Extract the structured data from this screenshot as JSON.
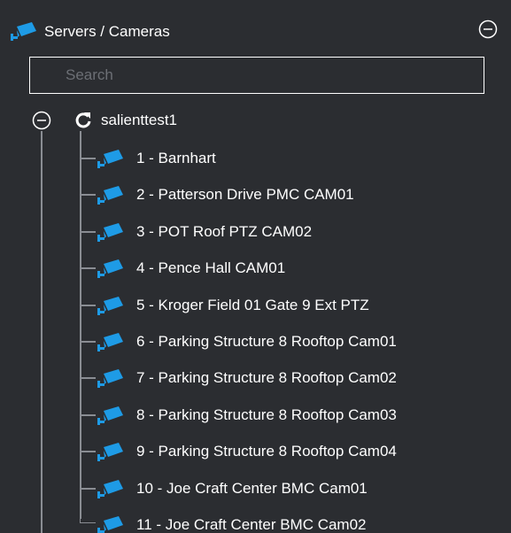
{
  "header": {
    "title": "Servers / Cameras",
    "icon": "security-camera-icon",
    "collapse_icon": "minus-circle-icon"
  },
  "search": {
    "placeholder": "Search",
    "value": ""
  },
  "tree": {
    "server": {
      "name": "salienttest1",
      "toggle_icon": "minus-circle-icon",
      "status_icon": "refresh-icon",
      "expanded": true
    },
    "cameras": [
      {
        "label": "1 - Barnhart"
      },
      {
        "label": "2 - Patterson Drive PMC CAM01"
      },
      {
        "label": "3 - POT Roof PTZ CAM02"
      },
      {
        "label": "4 - Pence Hall CAM01"
      },
      {
        "label": "5 - Kroger Field 01 Gate 9 Ext PTZ"
      },
      {
        "label": "6 - Parking Structure 8 Rooftop Cam01"
      },
      {
        "label": "7 - Parking Structure 8 Rooftop Cam02"
      },
      {
        "label": "8 - Parking Structure 8 Rooftop Cam03"
      },
      {
        "label": "9 - Parking Structure 8 Rooftop Cam04"
      },
      {
        "label": "10 - Joe Craft Center BMC Cam01"
      },
      {
        "label": "11 - Joe Craft Center BMC Cam02"
      }
    ]
  },
  "colors": {
    "background": "#2b2d31",
    "camera_icon": "#1e9be6",
    "text": "#ffffff",
    "tree_lines": "#8a8d93"
  }
}
